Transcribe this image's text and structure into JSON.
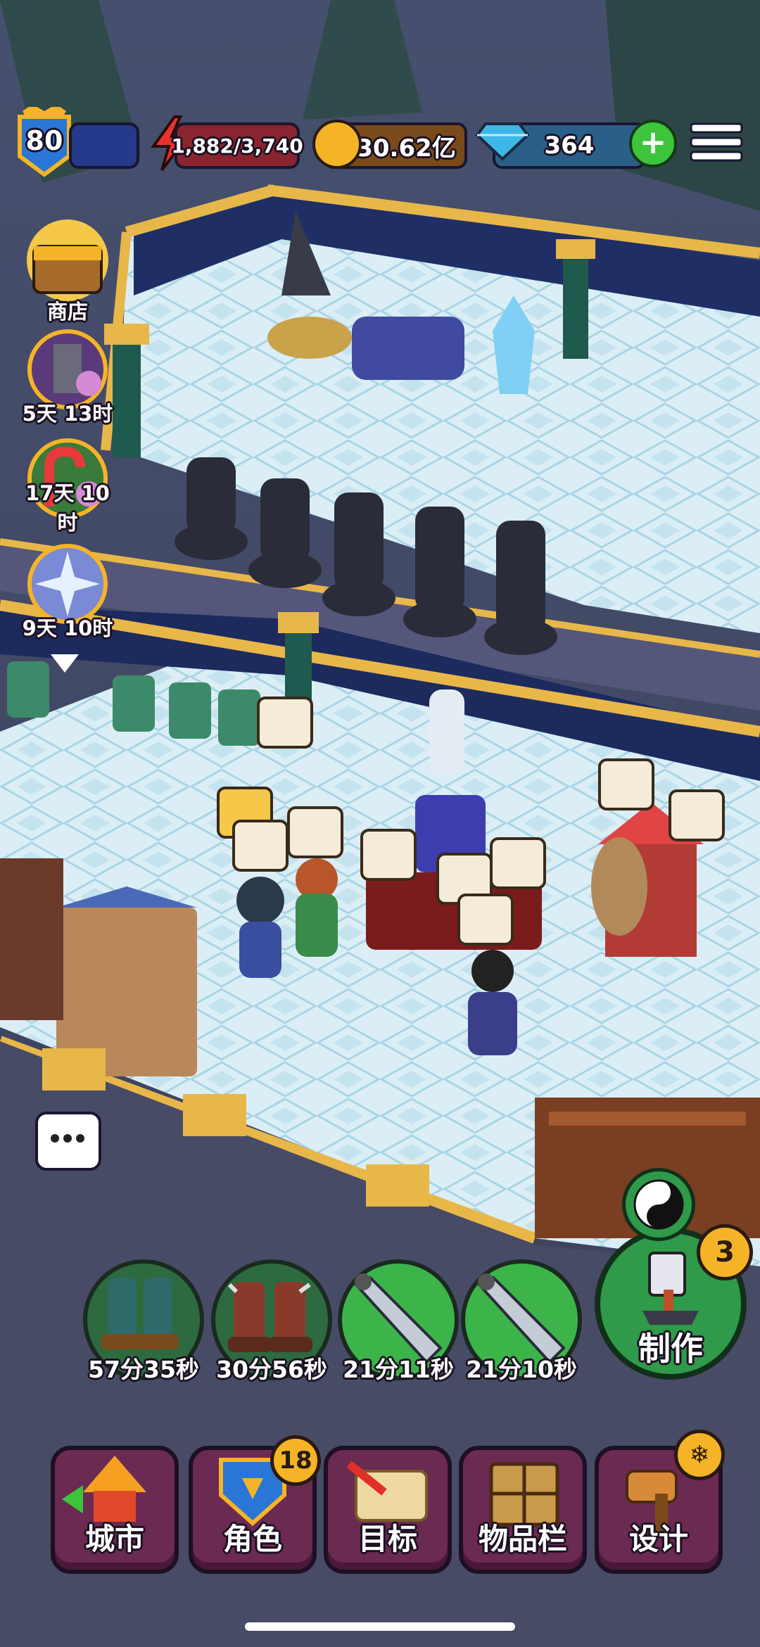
{
  "hud": {
    "level": "80",
    "energy": "1,882/3,740",
    "gold": "30.62亿",
    "gems": "364"
  },
  "offers": [
    {
      "label": "商店"
    },
    {
      "label": "5天 13时"
    },
    {
      "label": "17天 10时"
    },
    {
      "label": "9天 10时"
    }
  ],
  "crafting_queue": [
    {
      "time": "57分35秒"
    },
    {
      "time": "30分56秒"
    },
    {
      "time": "21分11秒"
    },
    {
      "time": "21分10秒"
    }
  ],
  "craft_button": {
    "label": "制作",
    "count": "3"
  },
  "nav": {
    "city": "城市",
    "characters": "角色",
    "characters_badge": "18",
    "goals": "目标",
    "inventory": "物品栏",
    "design": "设计"
  },
  "colors": {
    "gold": "#f5b427",
    "energy_red": "#d8322a",
    "gem_blue": "#3fb6e8",
    "plus_green": "#3cc43c"
  }
}
